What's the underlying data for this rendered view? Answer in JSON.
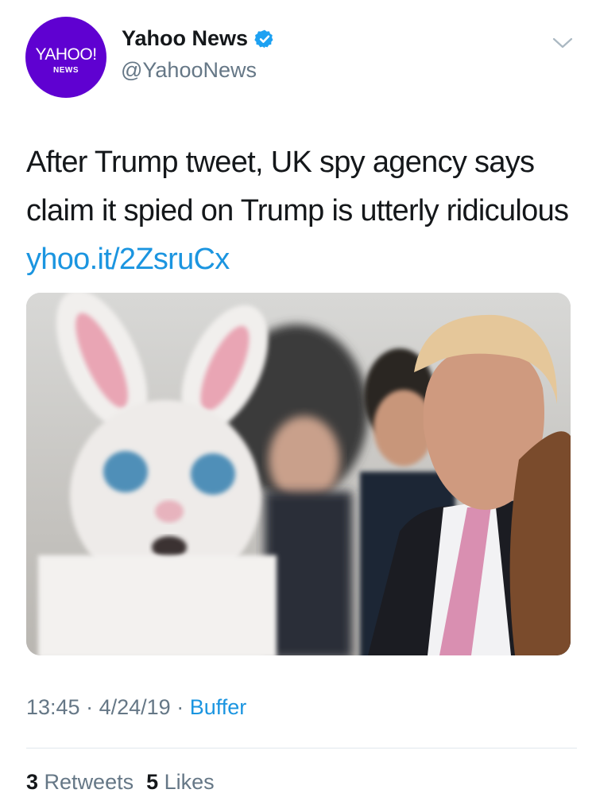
{
  "account": {
    "avatar_brand": "YAHOO!",
    "avatar_sub": "NEWS",
    "display_name": "Yahoo News",
    "handle": "@YahooNews"
  },
  "tweet": {
    "text": "After Trump tweet, UK spy agency says claim it spied on Trump is utterly ridiculous",
    "link": "yhoo.it/2ZsruCx",
    "time": "13:45",
    "date": "4/24/19",
    "separator": "·",
    "source": "Buffer"
  },
  "stats": {
    "retweets_count": "3",
    "retweets_label": "Retweets",
    "likes_count": "5",
    "likes_label": "Likes"
  },
  "colors": {
    "avatar_bg": "#5f01d1",
    "link": "#1b95e0",
    "muted": "#657786",
    "verified": "#1da1f2"
  },
  "icons": {
    "verified": "verified-badge-icon",
    "menu": "chevron-down-icon"
  }
}
